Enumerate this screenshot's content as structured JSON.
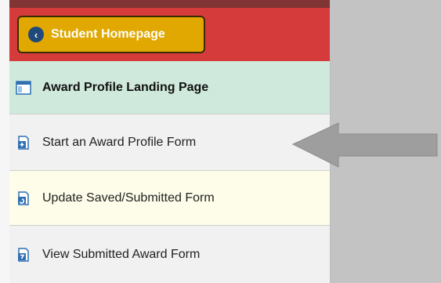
{
  "header": {
    "home_button_label": "Student Homepage"
  },
  "nav": {
    "landing_label": "Award Profile Landing Page",
    "items": [
      {
        "label": "Start an Award Profile Form"
      },
      {
        "label": "Update Saved/Submitted Form"
      },
      {
        "label": "View Submitted Award Form"
      }
    ]
  },
  "colors": {
    "header_bg": "#d63b3b",
    "button_bg": "#e0a800",
    "landing_bg": "#cfe9dc",
    "highlight_bg": "#fdfde9",
    "icon_blue": "#2f6fb3",
    "arrow_gray": "#9e9e9e"
  },
  "icons": {
    "back": "chevron-left-circle-icon",
    "landing": "window-icon",
    "start": "add-document-icon",
    "update": "edit-document-icon",
    "view": "view-document-icon",
    "pointer": "left-arrow-icon"
  }
}
